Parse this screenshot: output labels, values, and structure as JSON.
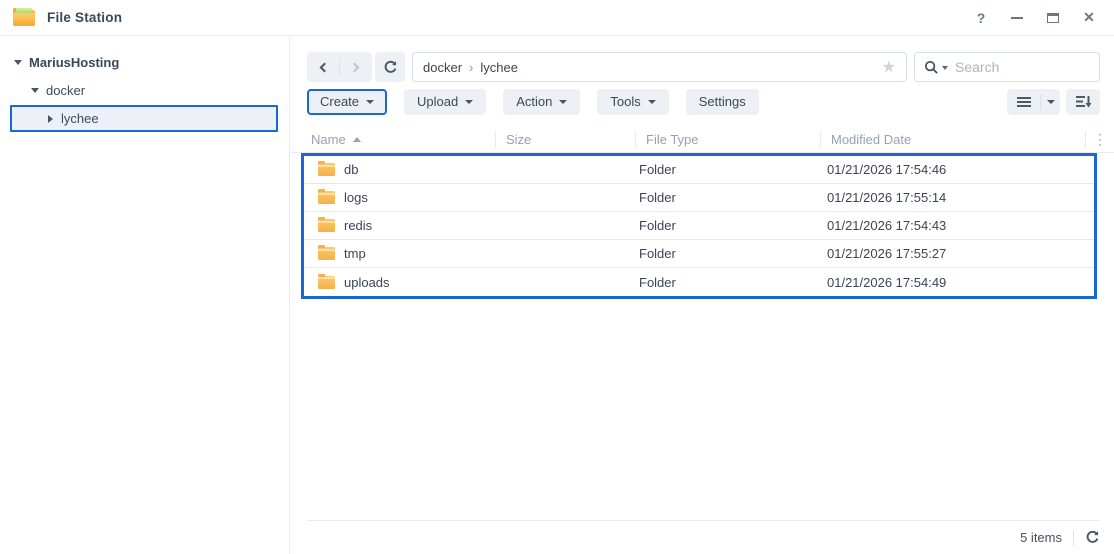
{
  "window": {
    "title": "File Station",
    "help_icon": "?",
    "close_icon": "✕"
  },
  "sidebar": {
    "items": [
      {
        "label": "MariusHosting",
        "level": 0,
        "expanded": true
      },
      {
        "label": "docker",
        "level": 1,
        "expanded": true
      },
      {
        "label": "lychee",
        "level": 2,
        "expanded": false,
        "selected": true
      }
    ]
  },
  "nav": {
    "breadcrumb": {
      "segments": [
        "docker",
        "lychee"
      ],
      "separator": "›"
    },
    "star_icon": "★",
    "search": {
      "placeholder": "Search"
    }
  },
  "toolbar": {
    "buttons": [
      {
        "label": "Create",
        "highlighted": true
      },
      {
        "label": "Upload"
      },
      {
        "label": "Action"
      },
      {
        "label": "Tools"
      },
      {
        "label": "Settings"
      }
    ]
  },
  "table": {
    "columns": [
      "Name",
      "Size",
      "File Type",
      "Modified Date"
    ],
    "sort": {
      "column": "Name",
      "direction": "asc"
    },
    "menu_icon": "⋮",
    "rows": [
      {
        "name": "db",
        "size": "",
        "type": "Folder",
        "modified": "01/21/2026 17:54:46"
      },
      {
        "name": "logs",
        "size": "",
        "type": "Folder",
        "modified": "01/21/2026 17:55:14"
      },
      {
        "name": "redis",
        "size": "",
        "type": "Folder",
        "modified": "01/21/2026 17:54:43"
      },
      {
        "name": "tmp",
        "size": "",
        "type": "Folder",
        "modified": "01/21/2026 17:55:27"
      },
      {
        "name": "uploads",
        "size": "",
        "type": "Folder",
        "modified": "01/21/2026 17:54:49"
      }
    ]
  },
  "statusbar": {
    "count": "5 items"
  },
  "colors": {
    "accent_blue": "#1b68d5",
    "folder_amber": "#f5b045"
  }
}
